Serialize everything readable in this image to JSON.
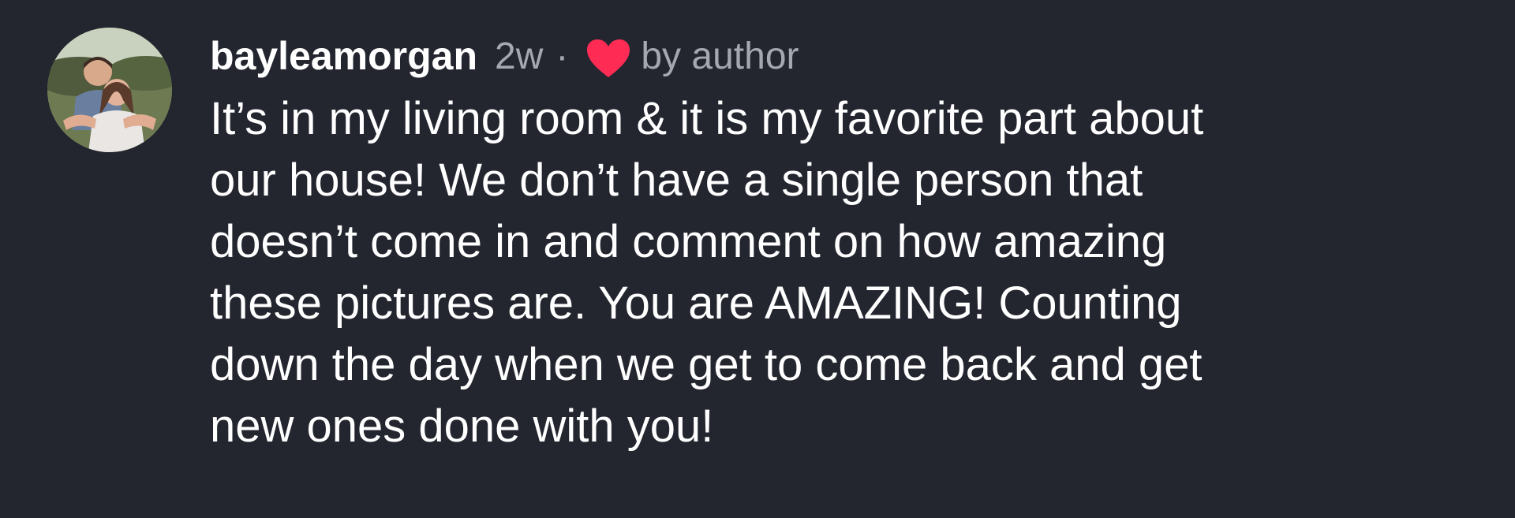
{
  "comment": {
    "username": "bayleamorgan",
    "timestamp": "2w",
    "separator": "·",
    "like_label": "by author",
    "heart_color": "#fe2c55",
    "avatar_icon": "profile-photo",
    "text_lines": [
      "It’s in my living room & it is my favorite part about",
      "our house! We don’t have a single person that",
      "doesn’t come in and comment on how amazing",
      "these pictures are. You are AMAZING! Counting",
      "down the day when we get to come back and get",
      "new ones done with you!"
    ]
  },
  "theme": {
    "background": "#23252f",
    "text": "#ffffff",
    "muted": "#a6a8b0"
  }
}
